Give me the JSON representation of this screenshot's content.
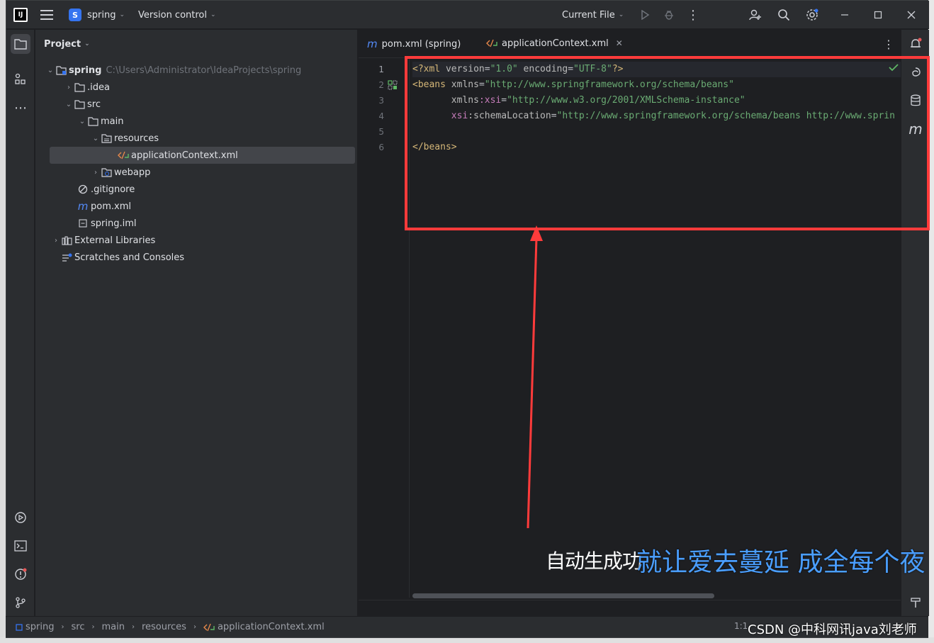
{
  "window": {
    "project_name": "spring",
    "project_initial": "S",
    "vcs_label": "Version control",
    "run_config": "Current File"
  },
  "project_panel": {
    "title": "Project",
    "tree": [
      {
        "label": "spring",
        "path": "C:\\Users\\Administrator\\IdeaProjects\\spring",
        "icon": "module-folder-icon",
        "expanded": true
      },
      {
        "label": ".idea",
        "icon": "folder-icon",
        "expanded": false
      },
      {
        "label": "src",
        "icon": "folder-icon",
        "expanded": true
      },
      {
        "label": "main",
        "icon": "folder-icon",
        "expanded": true
      },
      {
        "label": "resources",
        "icon": "resources-folder-icon",
        "expanded": true
      },
      {
        "label": "applicationContext.xml",
        "icon": "xml-file-icon",
        "selected": true
      },
      {
        "label": "webapp",
        "icon": "web-folder-icon",
        "expanded": false
      },
      {
        "label": ".gitignore",
        "icon": "ignore-file-icon"
      },
      {
        "label": "pom.xml",
        "icon": "maven-file-icon"
      },
      {
        "label": "spring.iml",
        "icon": "iml-file-icon"
      },
      {
        "label": "External Libraries",
        "icon": "libraries-icon",
        "expanded": false
      },
      {
        "label": "Scratches and Consoles",
        "icon": "scratches-icon"
      }
    ]
  },
  "editor": {
    "tabs": [
      {
        "label": "pom.xml (spring)",
        "icon": "maven-file-icon",
        "active": false
      },
      {
        "label": "applicationContext.xml",
        "icon": "xml-file-icon",
        "active": true
      }
    ],
    "line_numbers": [
      "1",
      "2",
      "3",
      "4",
      "5",
      "6"
    ],
    "code": {
      "l1_open": "<?xml ",
      "l1_a1": "version",
      "l1_eq1": "=",
      "l1_v1": "\"1.0\"",
      "l1_a2": " encoding",
      "l1_eq2": "=",
      "l1_v2": "\"UTF-8\"",
      "l1_close": "?>",
      "l2_open": "<beans ",
      "l2_a1": "xmlns",
      "l2_eq": "=",
      "l2_v1": "\"http://www.springframework.org/schema/beans\"",
      "l3_indent": "       ",
      "l3_a1": "xmlns",
      "l3_ns": ":xsi",
      "l3_eq": "=",
      "l3_v1": "\"http://www.w3.org/2001/XMLSchema-instance\"",
      "l4_indent": "       ",
      "l4_ns": "xsi",
      "l4_a1": ":schemaLocation",
      "l4_eq": "=",
      "l4_v1": "\"http://www.springframework.org/schema/beans http://www.sprin",
      "l6_close": "</beans>"
    }
  },
  "status_bar": {
    "breadcrumbs": [
      "spring",
      "src",
      "main",
      "resources",
      "applicationContext.xml"
    ],
    "position": "1:1"
  },
  "overlay": {
    "annotation": "自动生成功",
    "lyric": "就让爱去蔓延 成全每个夜",
    "watermark": "CSDN @中科网讯java刘老师",
    "highlight_color": "#ff3b3b",
    "lyric_color": "#4a9eff"
  },
  "colors": {
    "accent": "#3574f0",
    "tag": "#d5b778",
    "string": "#6aab73",
    "namespace_attr": "#c77dbb",
    "check": "#5fb865"
  }
}
